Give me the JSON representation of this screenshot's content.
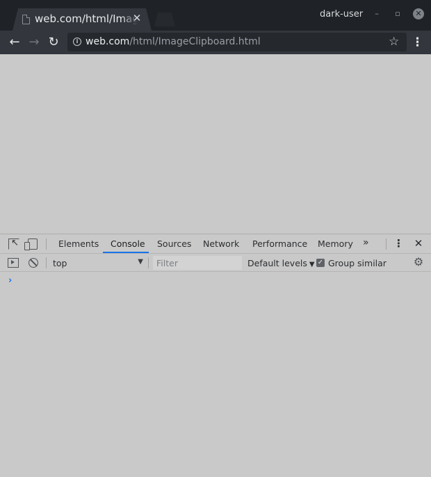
{
  "browser": {
    "tab": {
      "title": "web.com/html/ImageClipboard.html",
      "close_glyph": "✕",
      "icon": "file-icon"
    },
    "profile_name": "dark-user",
    "window_controls": {
      "minimize": "–",
      "maximize": "▫",
      "close": "✕"
    },
    "toolbar": {
      "back_glyph": "←",
      "forward_glyph": "→",
      "reload_glyph": "↻",
      "info_glyph": "i",
      "url_host": "web.com",
      "url_path": "/html/ImageClipboard.html",
      "star_glyph": "☆",
      "menu_glyph": "⋮"
    }
  },
  "devtools": {
    "tabs": [
      {
        "label": "Elements",
        "active": false
      },
      {
        "label": "Console",
        "active": true
      },
      {
        "label": "Sources",
        "active": false
      },
      {
        "label": "Network",
        "active": false
      },
      {
        "label": "Performance",
        "active": false
      },
      {
        "label": "Memory",
        "active": false
      }
    ],
    "more_glyph": "»",
    "kebab_glyph": "⋮",
    "close_glyph": "✕",
    "console": {
      "context": "top",
      "context_caret": "▼",
      "filter_placeholder": "Filter",
      "filter_value": "",
      "levels_label": "Default levels",
      "levels_caret": "▼",
      "group_similar_label": "Group similar",
      "group_similar_checked": true,
      "check_glyph": "✓",
      "gear_glyph": "⚙",
      "prompt_glyph": "›"
    }
  },
  "colors": {
    "titlebar": "#1f2226",
    "toolbar": "#33373d",
    "page_bg": "#c9c9c9",
    "accent": "#1a73e8"
  }
}
